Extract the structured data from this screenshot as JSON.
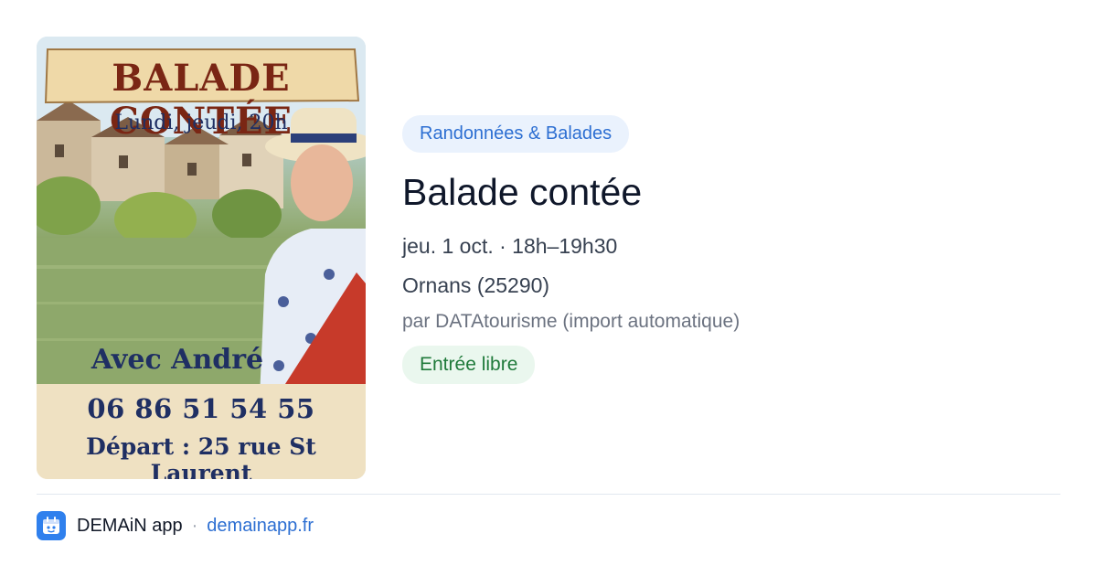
{
  "poster": {
    "title": "BALADE CONTÉE",
    "days": "Lundi, jeudi, 20h",
    "avec": "Avec André",
    "phone": "06 86 51 54 55",
    "depart": "Départ : 25 rue St Laurent"
  },
  "event": {
    "category": "Randonnées & Balades",
    "title": "Balade contée",
    "datetime": "jeu. 1 oct. · 18h–19h30",
    "location": "Ornans (25290)",
    "organizer": "par DATAtourisme (import automatique)",
    "price": "Entrée libre"
  },
  "footer": {
    "app_name": "DEMAiN app",
    "separator": "·",
    "link": "demainapp.fr"
  },
  "colors": {
    "accent": "#2d6fd2",
    "badge_blue_bg": "#eaf2fd",
    "badge_green_bg": "#eaf7ee",
    "badge_green_text": "#1f7a3a"
  }
}
